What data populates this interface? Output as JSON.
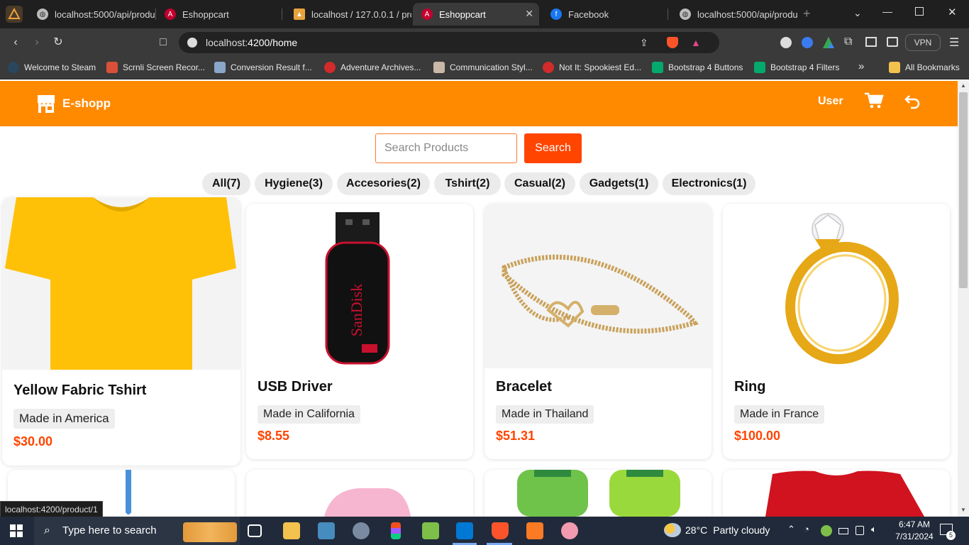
{
  "browser": {
    "tabs": [
      {
        "title": "localhost:5000/api/produ",
        "icon": "globe-icon"
      },
      {
        "title": "Eshoppcart",
        "icon": "angular-icon"
      },
      {
        "title": "localhost / 127.0.0.1 / prc",
        "icon": "phpmyadmin-icon"
      },
      {
        "title": "Eshoppcart",
        "icon": "angular-icon",
        "close": "✕"
      },
      {
        "title": "Facebook",
        "icon": "facebook-icon"
      },
      {
        "title": "localhost:5000/api/produ",
        "icon": "globe-icon"
      }
    ],
    "url_host": "localhost:",
    "url_path": "4200/home",
    "vpn_label": "VPN",
    "bookmarks": [
      "Welcome to Steam",
      "Scrnli Screen Recor...",
      "Conversion Result f...",
      "Adventure Archives...",
      "Communication Styl...",
      "Not It: Spookiest Ed...",
      "Bootstrap 4 Buttons",
      "Bootstrap 4 Filters"
    ],
    "more_bookmarks": "»",
    "all_bookmarks": "All Bookmarks",
    "status_url": "localhost:4200/product/1"
  },
  "header": {
    "brand": "E-shopp",
    "user_label": "User",
    "accent_color": "#ff8a00"
  },
  "search": {
    "placeholder": "Search Products",
    "button_label": "Search",
    "button_color": "#ff4500"
  },
  "categories": [
    "All(7)",
    "Hygiene(3)",
    "Accesories(2)",
    "Tshirt(2)",
    "Casual(2)",
    "Gadgets(1)",
    "Electronics(1)"
  ],
  "products": [
    {
      "name": "Yellow Fabric Tshirt",
      "origin": "Made in America",
      "price": "$30.00"
    },
    {
      "name": "USB Driver",
      "origin": "Made in California",
      "price": "$8.55"
    },
    {
      "name": "Bracelet",
      "origin": "Made in Thailand",
      "price": "$51.31"
    },
    {
      "name": "Ring",
      "origin": "Made in France",
      "price": "$100.00"
    }
  ],
  "taskbar": {
    "search_placeholder": "Type here to search",
    "weather_temp": "28°C",
    "weather_desc": "Partly cloudy",
    "time": "6:47 AM",
    "date": "7/31/2024",
    "notifications": "5"
  }
}
